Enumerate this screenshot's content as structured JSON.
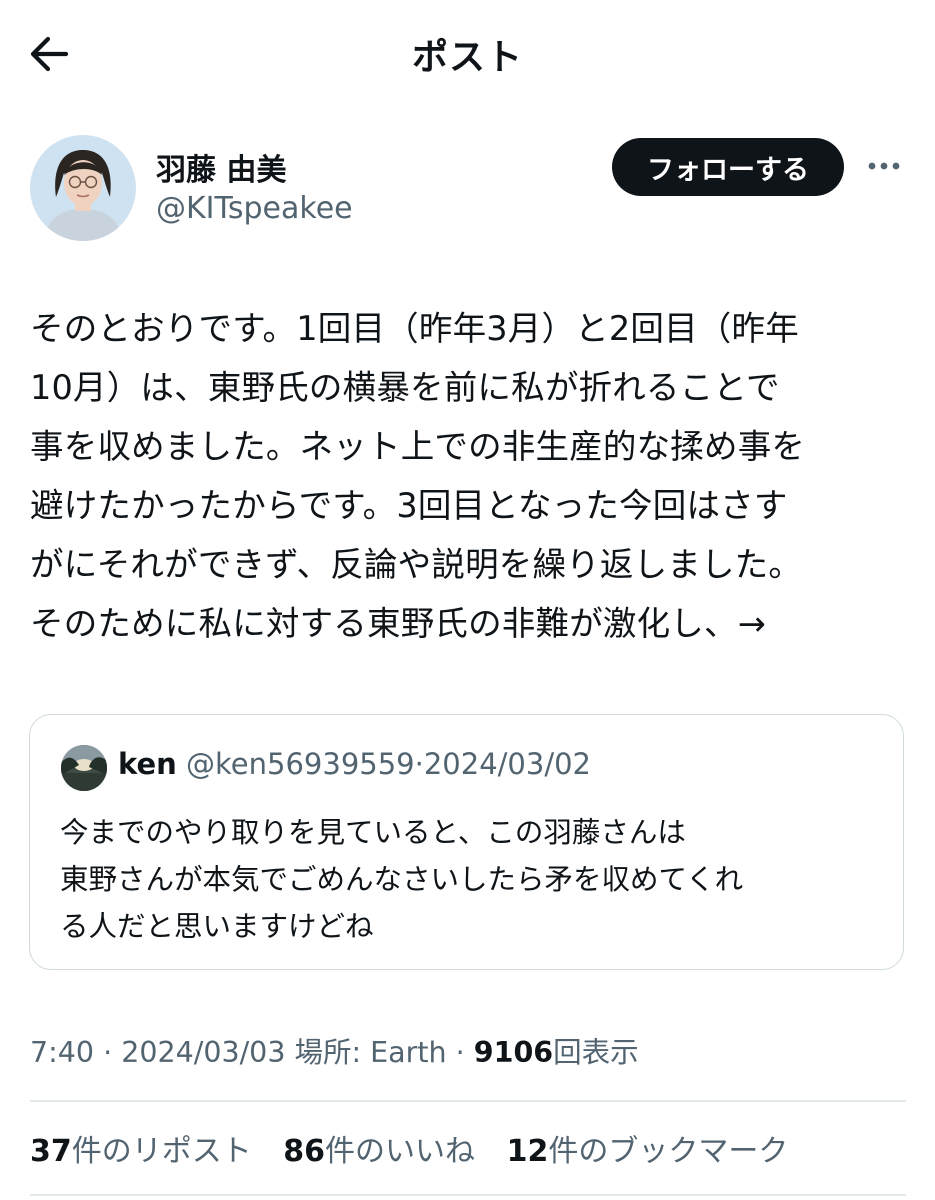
{
  "header": {
    "title": "ポスト",
    "back_icon": "arrow-left-icon"
  },
  "author": {
    "display_name": "羽藤 由美",
    "handle": "@KITspeakee",
    "follow_label": "フォローする",
    "more_icon": "more-horizontal-icon"
  },
  "post": {
    "lines": [
      "そのとおりです。1回目（昨年3月）と2回目（昨年",
      "10月）は、東野氏の横暴を前に私が折れることで",
      "事を収めました。ネット上での非生産的な揉め事を",
      "避けたかったからです。3回目となった今回はさす",
      "がにそれができず、反論や説明を繰り返しました。",
      "そのために私に対する東野氏の非難が激化し、→"
    ]
  },
  "quote": {
    "name": "ken",
    "handle": "@ken56939559",
    "separator": "·",
    "date": "2024/03/02",
    "lines": [
      "今までのやり取りを見ていると、この羽藤さんは",
      "東野さんが本気でごめんなさいしたら矛を収めてくれ",
      "る人だと思いますけどね"
    ]
  },
  "meta": {
    "time": "7:40",
    "sep1": "·",
    "date": "2024/03/03",
    "location": "場所: Earth",
    "sep2": "·",
    "views_count": "9106",
    "views_label": "回表示"
  },
  "stats": {
    "reposts_count": "37",
    "reposts_label": "件のリポスト",
    "likes_count": "86",
    "likes_label": "件のいいね",
    "bookmarks_count": "12",
    "bookmarks_label": "件のブックマーク"
  },
  "colors": {
    "text": "#0f1419",
    "secondary": "#536471",
    "follow_bg": "#0f1419",
    "border": "#cfd9de"
  }
}
